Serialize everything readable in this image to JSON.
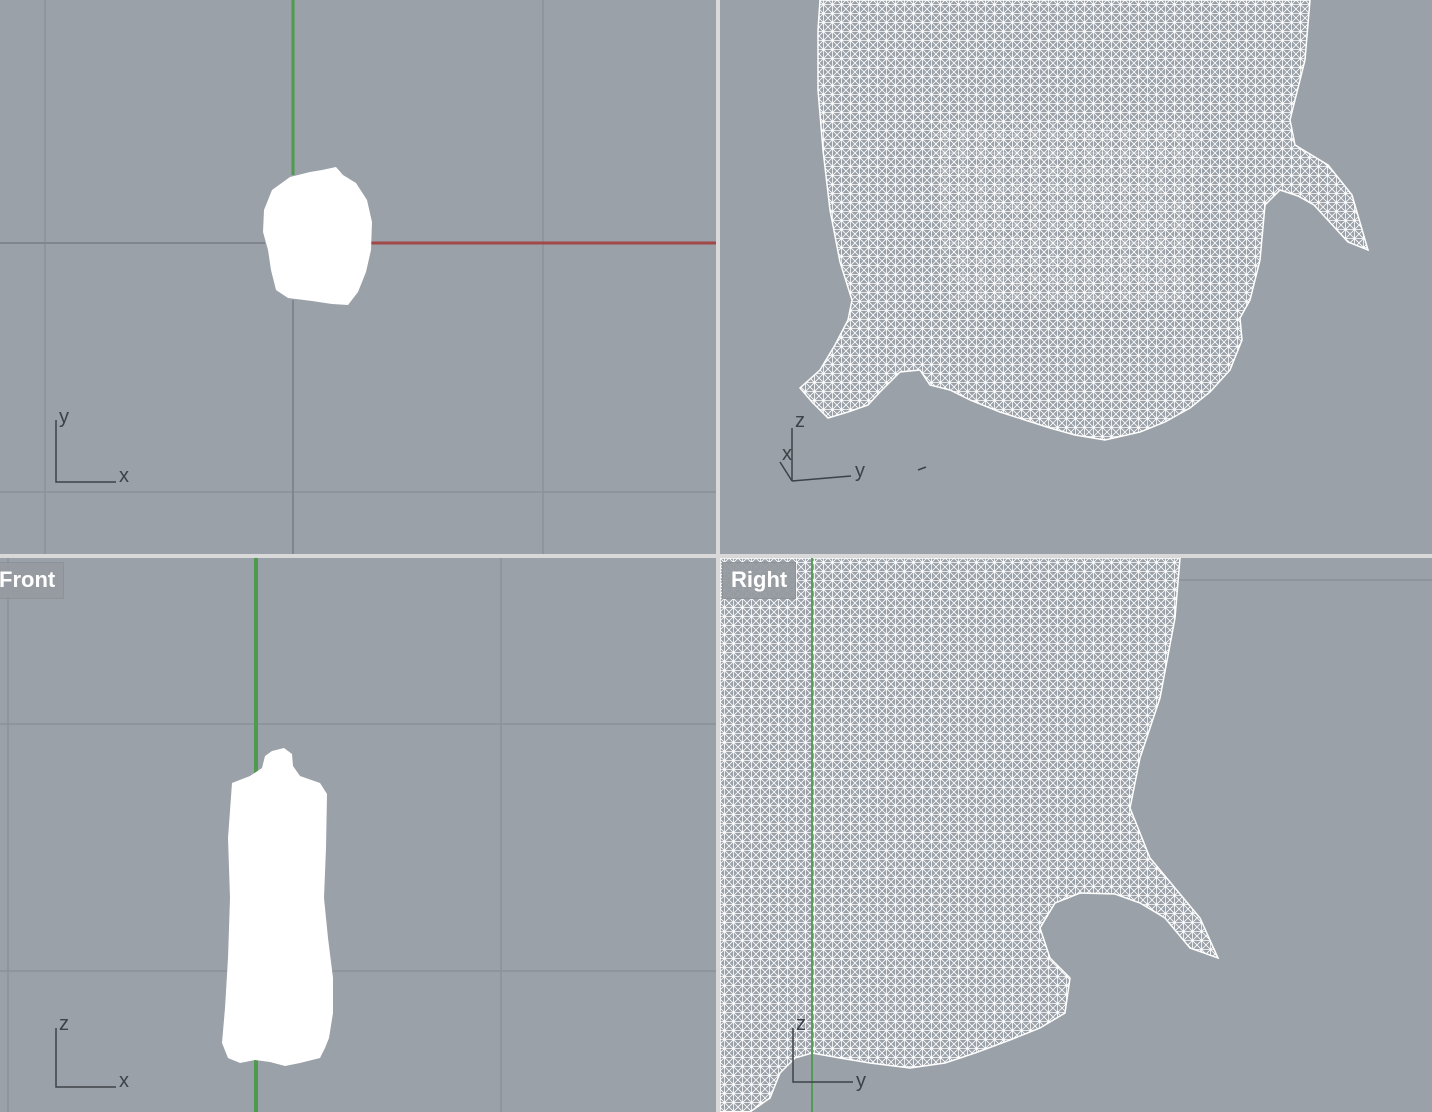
{
  "viewports": {
    "top": {
      "label": "",
      "axis_labels": {
        "a": "y",
        "b": "x"
      }
    },
    "perspective": {
      "label": "",
      "axis_labels": {
        "a": "z",
        "b": "x",
        "c": "y"
      }
    },
    "front": {
      "label": "Front",
      "axis_labels": {
        "a": "z",
        "b": "x"
      }
    },
    "right": {
      "label": "Right",
      "axis_labels": {
        "a": "z",
        "b": "y"
      }
    }
  },
  "colors": {
    "viewport_bg": "#9ba1a8",
    "grid": "#8c9199",
    "x_axis": "#a0484a",
    "y_axis": "#4e9a4e",
    "mesh": "#ffffff",
    "divider": "#d9d9d9"
  },
  "icons": [
    "axis-gizmo-icon"
  ]
}
